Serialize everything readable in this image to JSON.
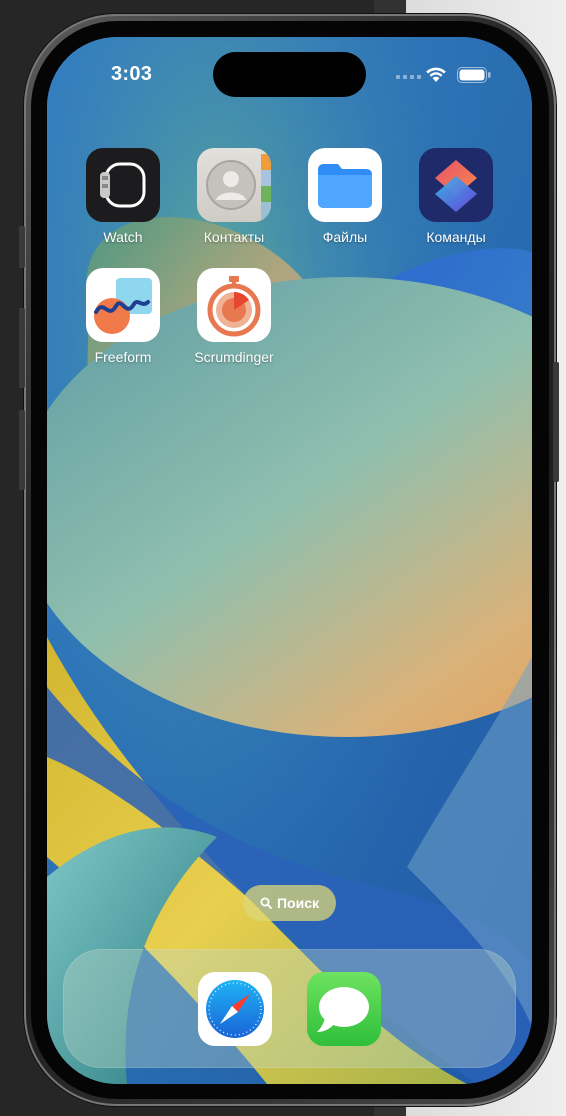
{
  "status_bar": {
    "time": "3:03"
  },
  "apps": [
    {
      "label": "Watch",
      "icon": "watch-icon"
    },
    {
      "label": "Контакты",
      "icon": "contacts-icon"
    },
    {
      "label": "Файлы",
      "icon": "files-icon"
    },
    {
      "label": "Команды",
      "icon": "shortcuts-icon"
    },
    {
      "label": "Freeform",
      "icon": "freeform-icon"
    },
    {
      "label": "Scrumdinger",
      "icon": "scrumdinger-icon"
    }
  ],
  "search": {
    "label": "Поиск"
  },
  "dock": [
    {
      "icon": "safari-icon"
    },
    {
      "icon": "messages-icon"
    }
  ],
  "colors": {
    "wallpaper_blue": "#2e6fb5",
    "wallpaper_orange": "#e8a15a",
    "wallpaper_yellow": "#e4c84a",
    "wallpaper_teal": "#5c9a8a"
  }
}
